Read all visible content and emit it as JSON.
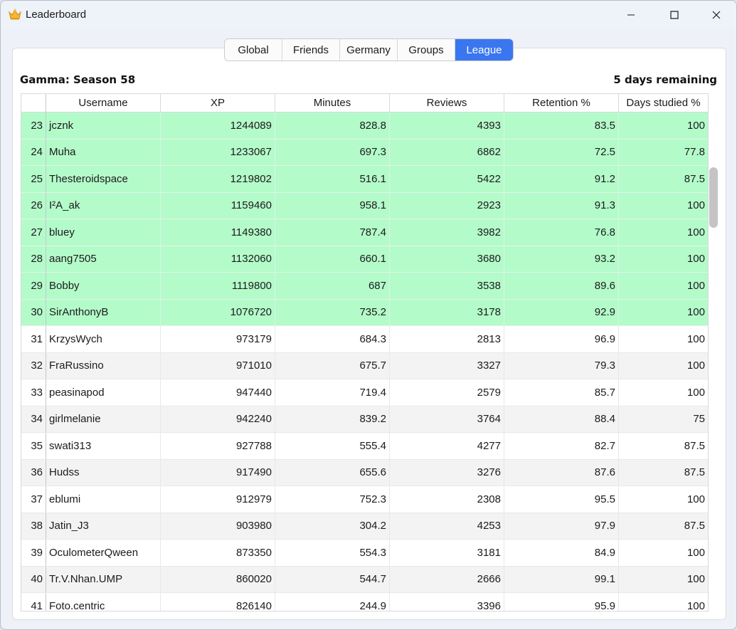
{
  "window": {
    "title": "Leaderboard",
    "app_icon": "crown-icon",
    "controls": [
      "minimize-icon",
      "maximize-icon",
      "close-icon"
    ]
  },
  "tabs": [
    {
      "label": "Global",
      "active": false
    },
    {
      "label": "Friends",
      "active": false
    },
    {
      "label": "Germany",
      "active": false
    },
    {
      "label": "Groups",
      "active": false
    },
    {
      "label": "League",
      "active": true
    }
  ],
  "header": {
    "season": "Gamma: Season 58",
    "remaining": "5 days remaining"
  },
  "colors": {
    "active_tab": "#3a76ef",
    "promotion_row": "#b4fbca",
    "alt_row": "#f3f3f3"
  },
  "table": {
    "columns": [
      "",
      "Username",
      "XP",
      "Minutes",
      "Reviews",
      "Retention %",
      "Days studied %"
    ],
    "rows": [
      {
        "rank": "23",
        "username": "jcznk",
        "xp": "1244089",
        "minutes": "828.8",
        "reviews": "4393",
        "retention": "83.5",
        "days": "100",
        "promoted": true
      },
      {
        "rank": "24",
        "username": "Muha",
        "xp": "1233067",
        "minutes": "697.3",
        "reviews": "6862",
        "retention": "72.5",
        "days": "77.8",
        "promoted": true
      },
      {
        "rank": "25",
        "username": "Thesteroidspace",
        "xp": "1219802",
        "minutes": "516.1",
        "reviews": "5422",
        "retention": "91.2",
        "days": "87.5",
        "promoted": true
      },
      {
        "rank": "26",
        "username": "I²A_ak",
        "xp": "1159460",
        "minutes": "958.1",
        "reviews": "2923",
        "retention": "91.3",
        "days": "100",
        "promoted": true
      },
      {
        "rank": "27",
        "username": "bluey",
        "xp": "1149380",
        "minutes": "787.4",
        "reviews": "3982",
        "retention": "76.8",
        "days": "100",
        "promoted": true
      },
      {
        "rank": "28",
        "username": "aang7505",
        "xp": "1132060",
        "minutes": "660.1",
        "reviews": "3680",
        "retention": "93.2",
        "days": "100",
        "promoted": true
      },
      {
        "rank": "29",
        "username": "Bobby",
        "xp": "1119800",
        "minutes": "687",
        "reviews": "3538",
        "retention": "89.6",
        "days": "100",
        "promoted": true
      },
      {
        "rank": "30",
        "username": "SirAnthonyB",
        "xp": "1076720",
        "minutes": "735.2",
        "reviews": "3178",
        "retention": "92.9",
        "days": "100",
        "promoted": true
      },
      {
        "rank": "31",
        "username": "KrzysWych",
        "xp": "973179",
        "minutes": "684.3",
        "reviews": "2813",
        "retention": "96.9",
        "days": "100",
        "promoted": false
      },
      {
        "rank": "32",
        "username": "FraRussino",
        "xp": "971010",
        "minutes": "675.7",
        "reviews": "3327",
        "retention": "79.3",
        "days": "100",
        "promoted": false
      },
      {
        "rank": "33",
        "username": "peasinapod",
        "xp": "947440",
        "minutes": "719.4",
        "reviews": "2579",
        "retention": "85.7",
        "days": "100",
        "promoted": false
      },
      {
        "rank": "34",
        "username": "girlmelanie",
        "xp": "942240",
        "minutes": "839.2",
        "reviews": "3764",
        "retention": "88.4",
        "days": "75",
        "promoted": false
      },
      {
        "rank": "35",
        "username": "swati313",
        "xp": "927788",
        "minutes": "555.4",
        "reviews": "4277",
        "retention": "82.7",
        "days": "87.5",
        "promoted": false
      },
      {
        "rank": "36",
        "username": "Hudss",
        "xp": "917490",
        "minutes": "655.6",
        "reviews": "3276",
        "retention": "87.6",
        "days": "87.5",
        "promoted": false
      },
      {
        "rank": "37",
        "username": "eblumi",
        "xp": "912979",
        "minutes": "752.3",
        "reviews": "2308",
        "retention": "95.5",
        "days": "100",
        "promoted": false
      },
      {
        "rank": "38",
        "username": "Jatin_J3",
        "xp": "903980",
        "minutes": "304.2",
        "reviews": "4253",
        "retention": "97.9",
        "days": "87.5",
        "promoted": false
      },
      {
        "rank": "39",
        "username": "OculometerQween",
        "xp": "873350",
        "minutes": "554.3",
        "reviews": "3181",
        "retention": "84.9",
        "days": "100",
        "promoted": false
      },
      {
        "rank": "40",
        "username": "Tr.V.Nhan.UMP",
        "xp": "860020",
        "minutes": "544.7",
        "reviews": "2666",
        "retention": "99.1",
        "days": "100",
        "promoted": false
      },
      {
        "rank": "41",
        "username": "Foto.centric",
        "xp": "826140",
        "minutes": "244.9",
        "reviews": "3396",
        "retention": "95.9",
        "days": "100",
        "promoted": false
      }
    ]
  }
}
